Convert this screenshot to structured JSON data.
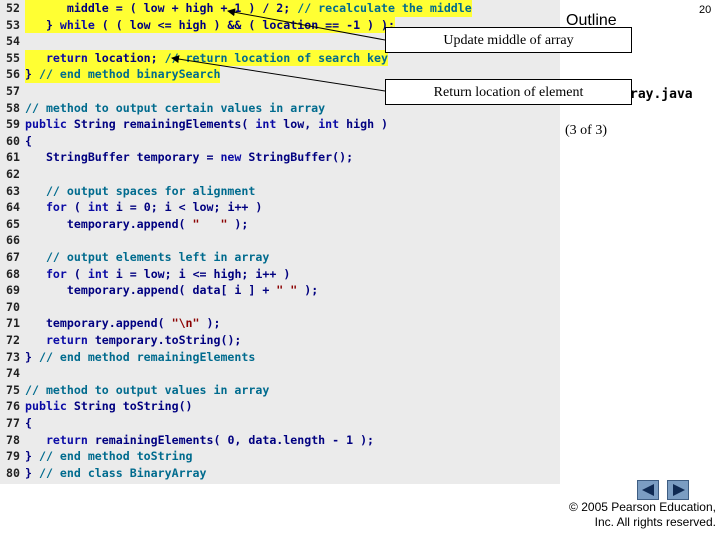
{
  "slide": {
    "page_number": "20",
    "outline_title": "Outline",
    "file_name": "ray.java",
    "part_label": "(3 of 3)"
  },
  "callouts": [
    {
      "text": "Update middle of array"
    },
    {
      "text": "Return location of element"
    }
  ],
  "navigation": {
    "prev_icon": "triangle-left-icon",
    "next_icon": "triangle-right-icon"
  },
  "copyright": {
    "line1": "© 2005 Pearson Education,",
    "line2": "Inc.  All rights reserved."
  },
  "colors": {
    "highlight": "#ffff33",
    "code_background": "#ebebeb",
    "nav_button": "#7b9dc2"
  },
  "code": [
    {
      "n": "52",
      "hl": true,
      "segs": [
        {
          "t": "      middle = ( low + high + 1 ) / 2; "
        },
        {
          "t": "// recalculate the middle",
          "c": "cm"
        }
      ]
    },
    {
      "n": "53",
      "hl": true,
      "segs": [
        {
          "t": "   } "
        },
        {
          "t": "while",
          "c": "kw"
        },
        {
          "t": " ( ( low <= high ) && ( location == -1 ) );"
        }
      ]
    },
    {
      "n": "54",
      "hl": false,
      "segs": []
    },
    {
      "n": "55",
      "hl": true,
      "segs": [
        {
          "t": "   "
        },
        {
          "t": "return",
          "c": "kw"
        },
        {
          "t": " location; "
        },
        {
          "t": "// return location of search key",
          "c": "cm"
        }
      ]
    },
    {
      "n": "56",
      "hl": true,
      "segs": [
        {
          "t": "} "
        },
        {
          "t": "// end method binarySearch",
          "c": "cm"
        }
      ]
    },
    {
      "n": "57",
      "hl": false,
      "segs": []
    },
    {
      "n": "58",
      "hl": false,
      "segs": [
        {
          "t": "// method to output certain values in array",
          "c": "cm"
        }
      ]
    },
    {
      "n": "59",
      "hl": false,
      "segs": [
        {
          "t": "public",
          "c": "kw"
        },
        {
          "t": " String remainingElements( "
        },
        {
          "t": "int",
          "c": "kw"
        },
        {
          "t": " low, "
        },
        {
          "t": "int",
          "c": "kw"
        },
        {
          "t": " high )"
        }
      ]
    },
    {
      "n": "60",
      "hl": false,
      "segs": [
        {
          "t": "{"
        }
      ]
    },
    {
      "n": "61",
      "hl": false,
      "segs": [
        {
          "t": "   StringBuffer temporary = "
        },
        {
          "t": "new",
          "c": "kw"
        },
        {
          "t": " StringBuffer();"
        }
      ]
    },
    {
      "n": "62",
      "hl": false,
      "segs": []
    },
    {
      "n": "63",
      "hl": false,
      "segs": [
        {
          "t": "   "
        },
        {
          "t": "// output spaces for alignment",
          "c": "cm"
        }
      ]
    },
    {
      "n": "64",
      "hl": false,
      "segs": [
        {
          "t": "   "
        },
        {
          "t": "for",
          "c": "kw"
        },
        {
          "t": " ( "
        },
        {
          "t": "int",
          "c": "kw"
        },
        {
          "t": " i = 0; i < low; i++ )"
        }
      ]
    },
    {
      "n": "65",
      "hl": false,
      "segs": [
        {
          "t": "      temporary.append( "
        },
        {
          "t": "\"   \"",
          "c": "st"
        },
        {
          "t": " );"
        }
      ]
    },
    {
      "n": "66",
      "hl": false,
      "segs": []
    },
    {
      "n": "67",
      "hl": false,
      "segs": [
        {
          "t": "   "
        },
        {
          "t": "// output elements left in array",
          "c": "cm"
        }
      ]
    },
    {
      "n": "68",
      "hl": false,
      "segs": [
        {
          "t": "   "
        },
        {
          "t": "for",
          "c": "kw"
        },
        {
          "t": " ( "
        },
        {
          "t": "int",
          "c": "kw"
        },
        {
          "t": " i = low; i <= high; i++ )"
        }
      ]
    },
    {
      "n": "69",
      "hl": false,
      "segs": [
        {
          "t": "      temporary.append( data[ i ] + "
        },
        {
          "t": "\" \"",
          "c": "st"
        },
        {
          "t": " );"
        }
      ]
    },
    {
      "n": "70",
      "hl": false,
      "segs": []
    },
    {
      "n": "71",
      "hl": false,
      "segs": [
        {
          "t": "   temporary.append( "
        },
        {
          "t": "\"\\n\"",
          "c": "st"
        },
        {
          "t": " );"
        }
      ]
    },
    {
      "n": "72",
      "hl": false,
      "segs": [
        {
          "t": "   "
        },
        {
          "t": "return",
          "c": "kw"
        },
        {
          "t": " temporary.toString();"
        }
      ]
    },
    {
      "n": "73",
      "hl": false,
      "segs": [
        {
          "t": "} "
        },
        {
          "t": "// end method remainingElements",
          "c": "cm"
        }
      ]
    },
    {
      "n": "74",
      "hl": false,
      "segs": []
    },
    {
      "n": "75",
      "hl": false,
      "segs": [
        {
          "t": "// method to output values in array",
          "c": "cm"
        }
      ]
    },
    {
      "n": "76",
      "hl": false,
      "segs": [
        {
          "t": "public",
          "c": "kw"
        },
        {
          "t": " String toString()"
        }
      ]
    },
    {
      "n": "77",
      "hl": false,
      "segs": [
        {
          "t": "{"
        }
      ]
    },
    {
      "n": "78",
      "hl": false,
      "segs": [
        {
          "t": "   "
        },
        {
          "t": "return",
          "c": "kw"
        },
        {
          "t": " remainingElements( 0, data.length - 1 );"
        }
      ]
    },
    {
      "n": "79",
      "hl": false,
      "segs": [
        {
          "t": "} "
        },
        {
          "t": "// end method toString",
          "c": "cm"
        }
      ]
    },
    {
      "n": "80",
      "hl": false,
      "segs": [
        {
          "t": "} "
        },
        {
          "t": "// end class BinaryArray",
          "c": "cm"
        }
      ]
    }
  ]
}
